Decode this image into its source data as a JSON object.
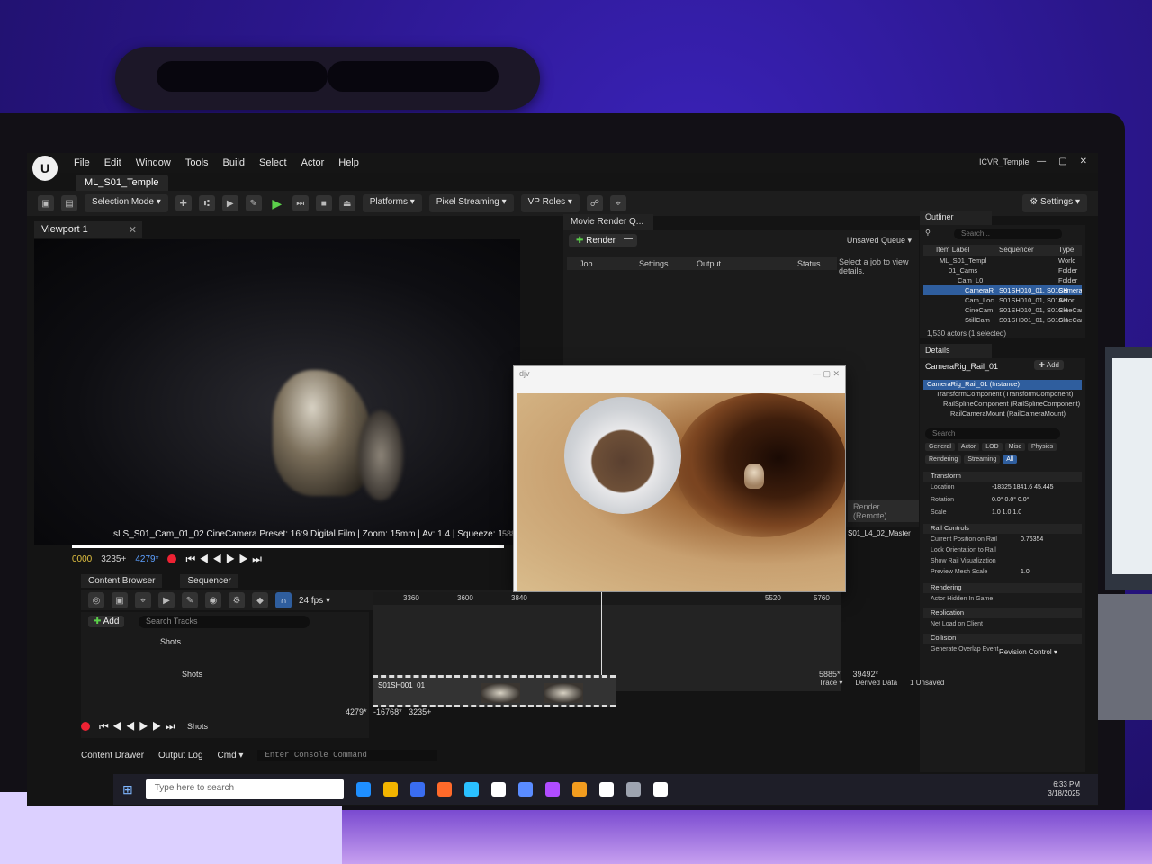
{
  "window": {
    "menu": [
      "File",
      "Edit",
      "Window",
      "Tools",
      "Build",
      "Select",
      "Actor",
      "Help"
    ],
    "project": "ICVR_Temple",
    "level_tab": "ML_S01_Temple"
  },
  "toolbar": {
    "mode": "Selection Mode",
    "platforms": "Platforms",
    "pixel_streaming": "Pixel Streaming",
    "vp_roles": "VP Roles",
    "settings": "Settings"
  },
  "viewport": {
    "tab": "Viewport 1",
    "cine_info": "sLS_S01_Cam_01_02 CineCamera Preset: 16:9 Digital Film | Zoom: 15mm | Av: 1.4 | Squeeze: 1",
    "frame_right": "5885"
  },
  "transport": {
    "start": "0000",
    "end": "3235+",
    "current": "4279*"
  },
  "movie_render": {
    "tab": "Movie Render Q...",
    "render_label": "Render",
    "unsaved": "Unsaved Queue",
    "columns": [
      "Job",
      "Settings",
      "Output",
      "Status"
    ],
    "hint": "Select a job to view details.",
    "remote": "Render (Remote)"
  },
  "image_window": {
    "title": "djv"
  },
  "outliner": {
    "tab": "Outliner",
    "search_placeholder": "Search...",
    "columns": [
      "Item Label",
      "Sequencer",
      "Type"
    ],
    "rows": [
      {
        "label": "ML_S01_Templ",
        "seq": "",
        "type": "World"
      },
      {
        "label": "01_Cams",
        "seq": "",
        "type": "Folder"
      },
      {
        "label": "Cam_L0",
        "seq": "",
        "type": "Folder"
      },
      {
        "label": "CameraR",
        "seq": "S01SH010_01, S01SH",
        "type": "Camera"
      },
      {
        "label": "Cam_Loc",
        "seq": "S01SH010_01, S01SH",
        "type": "Actor"
      },
      {
        "label": "CineCam",
        "seq": "S01SH010_01, S01SH",
        "type": "CineCar"
      },
      {
        "label": "StillCam",
        "seq": "S01SH001_01, S01SH",
        "type": "CineCar"
      }
    ],
    "count": "1,530 actors (1 selected)"
  },
  "details": {
    "tab": "Details",
    "object": "CameraRig_Rail_01",
    "add_label": "Add",
    "components": [
      "CameraRig_Rail_01 (Instance)",
      "TransformComponent (TransformComponent)",
      "RailSplineComponent (RailSplineComponent)",
      "RailCameraMount (RailCameraMount)"
    ],
    "search_placeholder": "Search",
    "filters_row1": [
      "General",
      "Actor",
      "LOD",
      "Misc",
      "Physics"
    ],
    "filters_row2": [
      "Rendering",
      "Streaming",
      "All"
    ],
    "sections": {
      "transform": "Transform",
      "rail_controls": "Rail Controls",
      "rendering": "Rendering",
      "replication": "Replication",
      "collision": "Collision"
    },
    "props": {
      "location": {
        "label": "Location",
        "val": "-18325  1841.6  45.445"
      },
      "rotation": {
        "label": "Rotation",
        "val": "0.0°  0.0°  0.0°"
      },
      "scale": {
        "label": "Scale",
        "val": "1.0  1.0  1.0"
      },
      "position": {
        "label": "Current Position on Rail",
        "val": "0.76354"
      },
      "orientation": {
        "label": "Lock Orientation to Rail",
        "val": ""
      },
      "visualization": {
        "label": "Show Rail Visualization",
        "val": ""
      },
      "mesh_scale": {
        "label": "Preview Mesh Scale",
        "val": "1.0"
      },
      "hidden": {
        "label": "Actor Hidden In Game",
        "val": ""
      },
      "net_load": {
        "label": "Net Load on Client",
        "val": ""
      },
      "overlap": {
        "label": "Generate Overlap Event",
        "val": ""
      }
    }
  },
  "lower": {
    "content_browser": "Content Browser",
    "sequencer": "Sequencer",
    "fps": "24 fps",
    "add_label": "Add",
    "search_tracks": "Search Tracks",
    "track_shots": "Shots",
    "ruler": [
      "3360",
      "3600",
      "3840",
      "5520",
      "5760"
    ],
    "film_label": "S01SH001_01",
    "seq_name": "S01_L4_02_Master",
    "range_a": "4279*",
    "range_b": "-16768*",
    "range_c": "3235+",
    "tl_right_a": "5885*",
    "tl_right_b": "39492*"
  },
  "bottom": {
    "content_drawer": "Content Drawer",
    "output_log": "Output Log",
    "cmd": "Cmd",
    "console_placeholder": "Enter Console Command",
    "trace": "Trace",
    "derived_data": "Derived Data",
    "unsaved": "1 Unsaved",
    "revision": "Revision Control"
  },
  "taskbar": {
    "search_placeholder": "Type here to search",
    "time": "6:33 PM",
    "date": "3/18/2025",
    "icon_colors": [
      "#1f8fff",
      "#f2b400",
      "#3a6df0",
      "#ff6a2a",
      "#2ac0ff",
      "#ffffff",
      "#5a8cff",
      "#b04cff",
      "#f29c1f",
      "#ffffff",
      "#9ea4b0",
      "#ffffff"
    ]
  }
}
